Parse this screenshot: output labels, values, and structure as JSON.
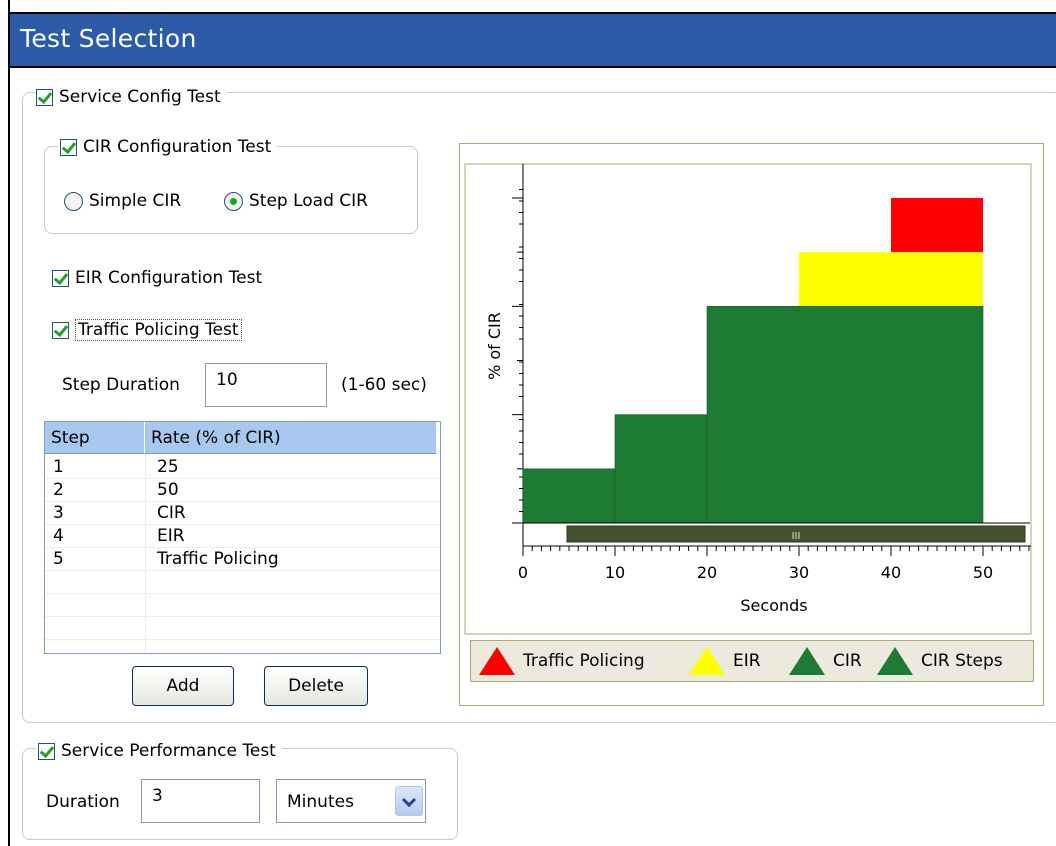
{
  "window": {
    "title": "Test Selection"
  },
  "service_config": {
    "label": "Service Config Test",
    "checked": true,
    "cir_config": {
      "label": "CIR Configuration Test",
      "checked": true,
      "options": [
        "Simple CIR",
        "Step Load CIR"
      ],
      "selected": "Step Load CIR"
    },
    "eir_config": {
      "label": "EIR Configuration Test",
      "checked": true
    },
    "traffic_policing": {
      "label": "Traffic Policing Test",
      "checked": true
    },
    "step_duration": {
      "label": "Step Duration",
      "value": "10",
      "range": "(1-60 sec)"
    },
    "steps_table": {
      "headers": [
        "Step",
        "Rate (% of CIR)"
      ],
      "rows": [
        [
          "1",
          "25"
        ],
        [
          "2",
          "50"
        ],
        [
          "3",
          "CIR"
        ],
        [
          "4",
          "EIR"
        ],
        [
          "5",
          "Traffic Policing"
        ]
      ]
    },
    "add_label": "Add",
    "delete_label": "Delete"
  },
  "chart_data": {
    "type": "area",
    "ylabel": "% of CIR",
    "xlabel": "Seconds",
    "x_ticks": [
      "0",
      "10",
      "20",
      "30",
      "40",
      "50"
    ],
    "xlim": [
      0,
      55
    ],
    "scrollbar_grip": "III",
    "series": [
      {
        "name": "CIR Steps",
        "color": "#1e7b34",
        "steps": [
          {
            "x0": 0,
            "x1": 10,
            "y": 25
          },
          {
            "x0": 10,
            "x1": 20,
            "y": 50
          }
        ]
      },
      {
        "name": "CIR",
        "color": "#1e7b34",
        "steps": [
          {
            "x0": 20,
            "x1": 50,
            "y": 100
          }
        ]
      },
      {
        "name": "EIR",
        "color": "#ffff00",
        "steps": [
          {
            "x0": 30,
            "x1": 50,
            "y": 125
          }
        ]
      },
      {
        "name": "Traffic Policing",
        "color": "#ff0000",
        "steps": [
          {
            "x0": 40,
            "x1": 50,
            "y": 150
          }
        ]
      }
    ],
    "legend": [
      {
        "name": "Traffic Policing",
        "color": "#ff0000"
      },
      {
        "name": "EIR",
        "color": "#ffff00"
      },
      {
        "name": "CIR",
        "color": "#1e7b34"
      },
      {
        "name": "CIR Steps",
        "color": "#1e7b34"
      }
    ]
  },
  "service_performance": {
    "label": "Service Performance Test",
    "checked": true,
    "duration_label": "Duration",
    "duration_value": "3",
    "unit": "Minutes"
  }
}
